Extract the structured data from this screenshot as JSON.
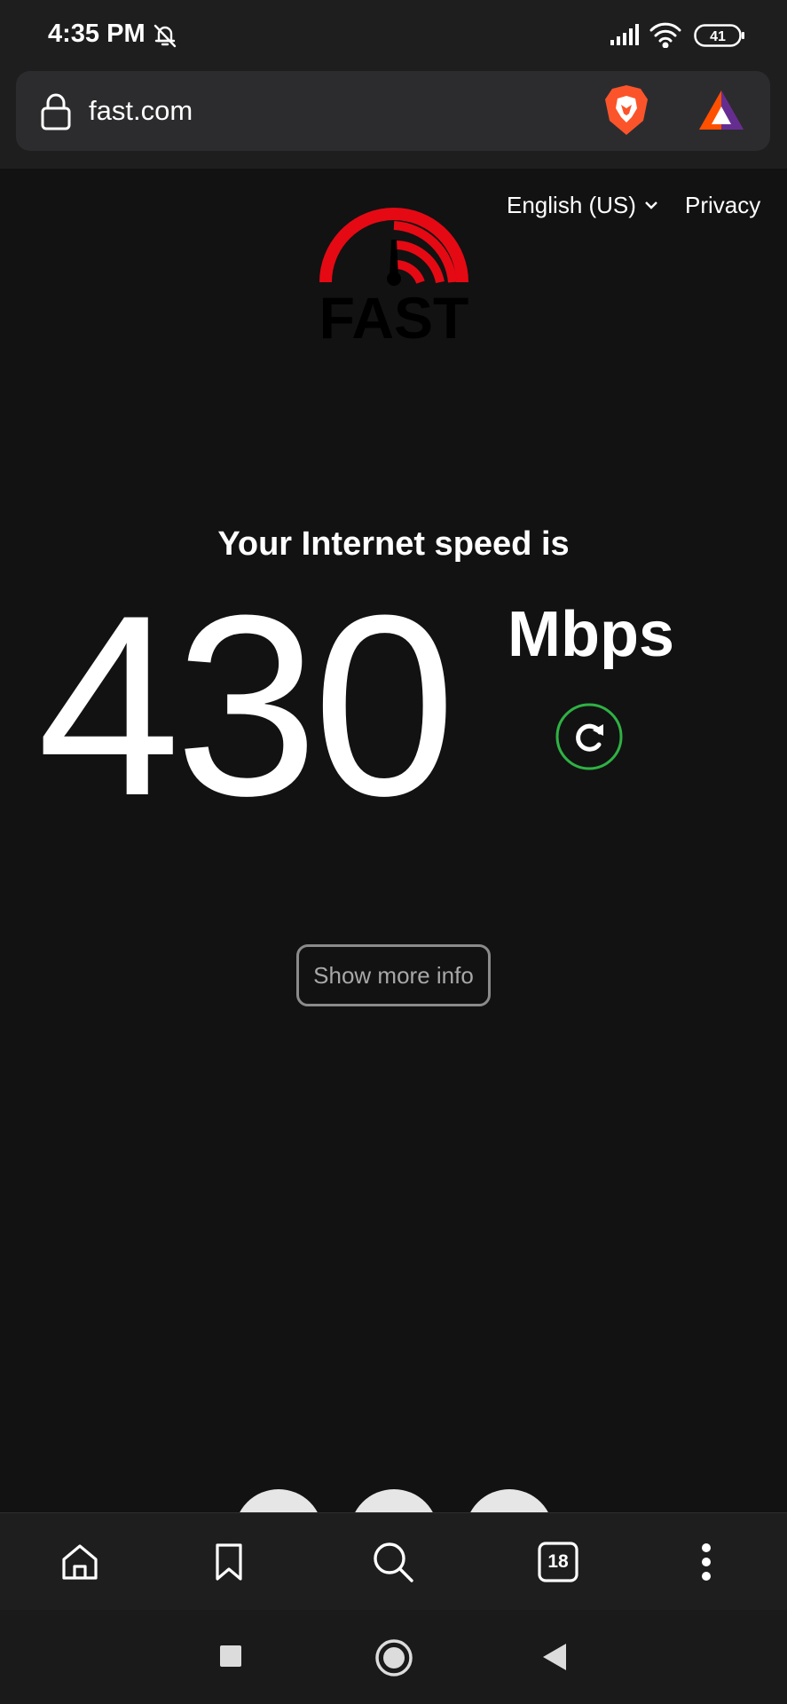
{
  "status_bar": {
    "time": "4:35 PM",
    "battery": "41",
    "icons": [
      "bell-off-icon",
      "signal-icon",
      "wifi-icon",
      "battery-icon"
    ]
  },
  "browser": {
    "url": "fast.com",
    "icons": [
      "lock-icon",
      "brave-shields-icon",
      "brave-rewards-icon"
    ]
  },
  "header": {
    "language": "English (US)",
    "privacy": "Privacy",
    "logo_text": "FAST"
  },
  "result": {
    "headline": "Your Internet speed is",
    "speed": "430",
    "units": "Mbps"
  },
  "more_info_label": "Show more info",
  "toolbar": {
    "tab_count": "18",
    "items": [
      "home-icon",
      "bookmark-icon",
      "search-icon",
      "tabs-icon",
      "more-icon"
    ]
  },
  "nav_bar": {
    "items": [
      "recents-icon",
      "home-nav-icon",
      "back-icon"
    ]
  },
  "colors": {
    "background": "#121212",
    "brand_red": "#e50914",
    "refresh_green": "#2fb144",
    "chrome": "#1e1e1e"
  }
}
